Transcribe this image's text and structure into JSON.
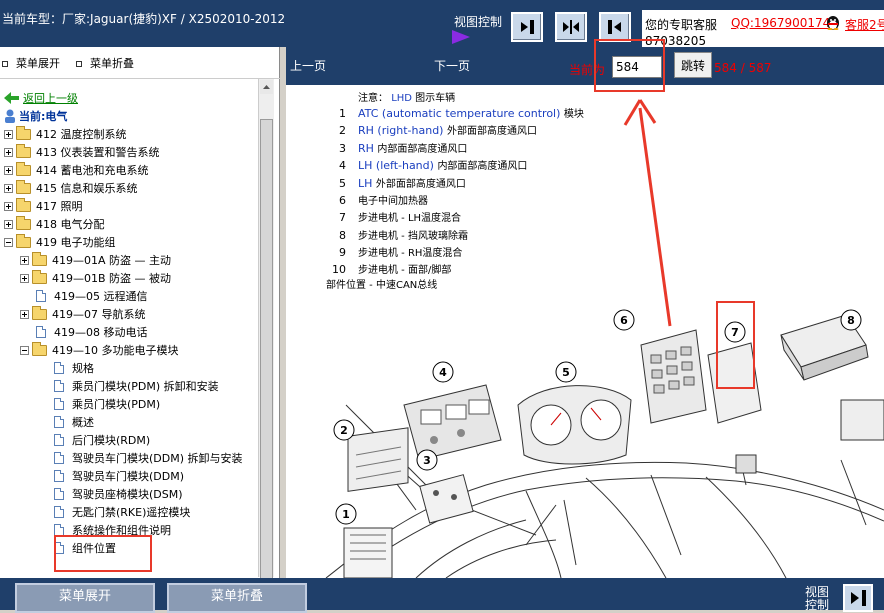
{
  "header": {
    "car_info": "当前车型：厂家:Jaguar(捷豹)XF / X2502010-2012",
    "view_control_label": "视图控制",
    "service_text": "您的专职客服",
    "service_qq": "QQ:1967900174",
    "service_kefu": "客服2号",
    "service_num": "87038205"
  },
  "left": {
    "expand_label": "菜单展开",
    "collapse_label": "菜单折叠",
    "back_label": "返回上一级",
    "current_label": "当前:电气",
    "tree": [
      {
        "label": "412 温度控制系统"
      },
      {
        "label": "413 仪表装置和警告系统"
      },
      {
        "label": "414 蓄电池和充电系统"
      },
      {
        "label": "415 信息和娱乐系统"
      },
      {
        "label": "417 照明"
      },
      {
        "label": "418 电气分配"
      },
      {
        "label": "419 电子功能组"
      },
      {
        "label": "419—01A 防盗 — 主动"
      },
      {
        "label": "419—01B 防盗 — 被动"
      },
      {
        "label": "419—05 远程通信"
      },
      {
        "label": "419—07 导航系统"
      },
      {
        "label": "419—08 移动电话"
      },
      {
        "label": "419—10 多功能电子模块"
      },
      {
        "label": "规格"
      },
      {
        "label": "乘员门模块(PDM) 拆卸和安装"
      },
      {
        "label": "乘员门模块(PDM)"
      },
      {
        "label": "概述"
      },
      {
        "label": "后门模块(RDM)"
      },
      {
        "label": "驾驶员车门模块(DDM) 拆卸与安装"
      },
      {
        "label": "驾驶员车门模块(DDM)"
      },
      {
        "label": "驾驶员座椅模块(DSM)"
      },
      {
        "label": "无匙门禁(RKE)遥控模块"
      },
      {
        "label": "系统操作和组件说明"
      },
      {
        "label": "组件位置"
      }
    ]
  },
  "nav": {
    "prev_label": "上一页",
    "next_label": "下一页",
    "page_label": "当前为",
    "page_value": "584",
    "jump_label": "跳转",
    "page_count": "584 / 587"
  },
  "content": {
    "note_prefix": "注意：",
    "note_lhd": "LHD",
    "note_suffix": "图示车辆",
    "legend": [
      {
        "num": "1",
        "en": "ATC (automatic temperature control)",
        "cn": "模块"
      },
      {
        "num": "2",
        "en": "RH (right-hand)",
        "cn": "外部面部高度通风口"
      },
      {
        "num": "3",
        "en": "RH",
        "cn": "内部面部高度通风口"
      },
      {
        "num": "4",
        "en": "LH (left-hand)",
        "cn": "内部面部高度通风口"
      },
      {
        "num": "5",
        "en": "LH",
        "cn": "外部面部高度通风口"
      },
      {
        "num": "6",
        "en": "",
        "cn": "电子中间加热器"
      },
      {
        "num": "7",
        "en": "",
        "cn": "步进电机 - LH温度混合"
      },
      {
        "num": "8",
        "en": "",
        "cn": "步进电机 - 挡风玻璃除霜"
      },
      {
        "num": "9",
        "en": "",
        "cn": "步进电机 - RH温度混合"
      },
      {
        "num": "10",
        "en": "",
        "cn": "步进电机 - 面部/脚部"
      }
    ],
    "parts_caption": "部件位置 - 中速CAN总线",
    "callouts": [
      "1",
      "2",
      "3",
      "4",
      "5",
      "6",
      "7",
      "8"
    ]
  },
  "footer": {
    "expand_label": "菜单展开",
    "collapse_label": "菜单折叠",
    "view_label": "视图控制"
  }
}
